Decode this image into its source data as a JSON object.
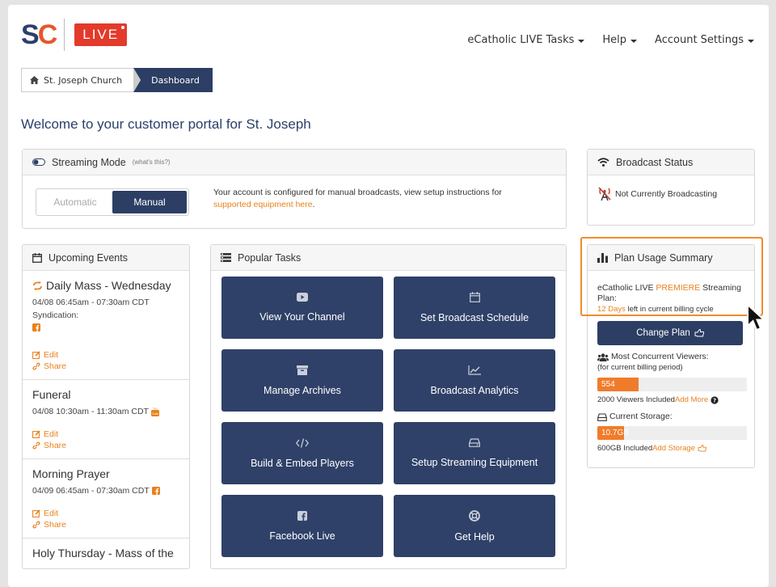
{
  "header": {
    "logo_sc": "SC",
    "logo_live": "LIVE",
    "nav": [
      "eCatholic LIVE Tasks",
      "Help",
      "Account Settings"
    ]
  },
  "breadcrumb": {
    "home": "St. Joseph Church",
    "active": "Dashboard"
  },
  "welcome": "Welcome to your customer portal for St. Joseph",
  "streaming": {
    "title": "Streaming Mode",
    "whats_this": "(what's this?)",
    "automatic": "Automatic",
    "manual": "Manual",
    "text_before": "Your account is configured for manual broadcasts, view setup instructions for ",
    "link": "supported equipment here",
    "text_after": "."
  },
  "broadcast": {
    "title": "Broadcast Status",
    "status": "Not Currently Broadcasting"
  },
  "events": {
    "title": "Upcoming Events",
    "items": [
      {
        "title": "Daily Mass - Wednesday",
        "time": "04/08 06:45am - 07:30am CDT",
        "syndication": "Syndication:",
        "edit": "Edit",
        "share": "Share"
      },
      {
        "title": "Funeral",
        "time": "04/08 10:30am - 11:30am CDT",
        "edit": "Edit",
        "share": "Share"
      },
      {
        "title": "Morning Prayer",
        "time": "04/09 06:45am - 07:30am CDT",
        "edit": "Edit",
        "share": "Share"
      },
      {
        "title": "Holy Thursday - Mass of the"
      }
    ]
  },
  "tasks": {
    "title": "Popular Tasks",
    "items": [
      "View Your Channel",
      "Set Broadcast Schedule",
      "Manage Archives",
      "Broadcast Analytics",
      "Build & Embed Players",
      "Setup Streaming Equipment",
      "Facebook Live",
      "Get Help"
    ]
  },
  "plan": {
    "title": "Plan Usage Summary",
    "line1a": "eCatholic LIVE ",
    "premiere": "PREMIERE",
    "line1b": " Streaming",
    "line2": "Plan:",
    "days": "12 Days",
    "days_rest": " left in current billing cycle",
    "change_button": "Change Plan",
    "viewers_label": "Most Concurrent Viewers:",
    "viewers_period": "(for current billing period)",
    "viewers_value": "554",
    "viewers_fraction": 0.277,
    "viewers_included": "2000 Viewers Included ",
    "add_more": "Add More",
    "storage_label": "Current Storage:",
    "storage_value": "10.7GB",
    "storage_fraction": 0.18,
    "storage_included": "600GB Included ",
    "add_storage": "Add Storage"
  },
  "colors": {
    "navy": "#2c3e63",
    "orange": "#e8821e",
    "live_red": "#e33a2c"
  }
}
